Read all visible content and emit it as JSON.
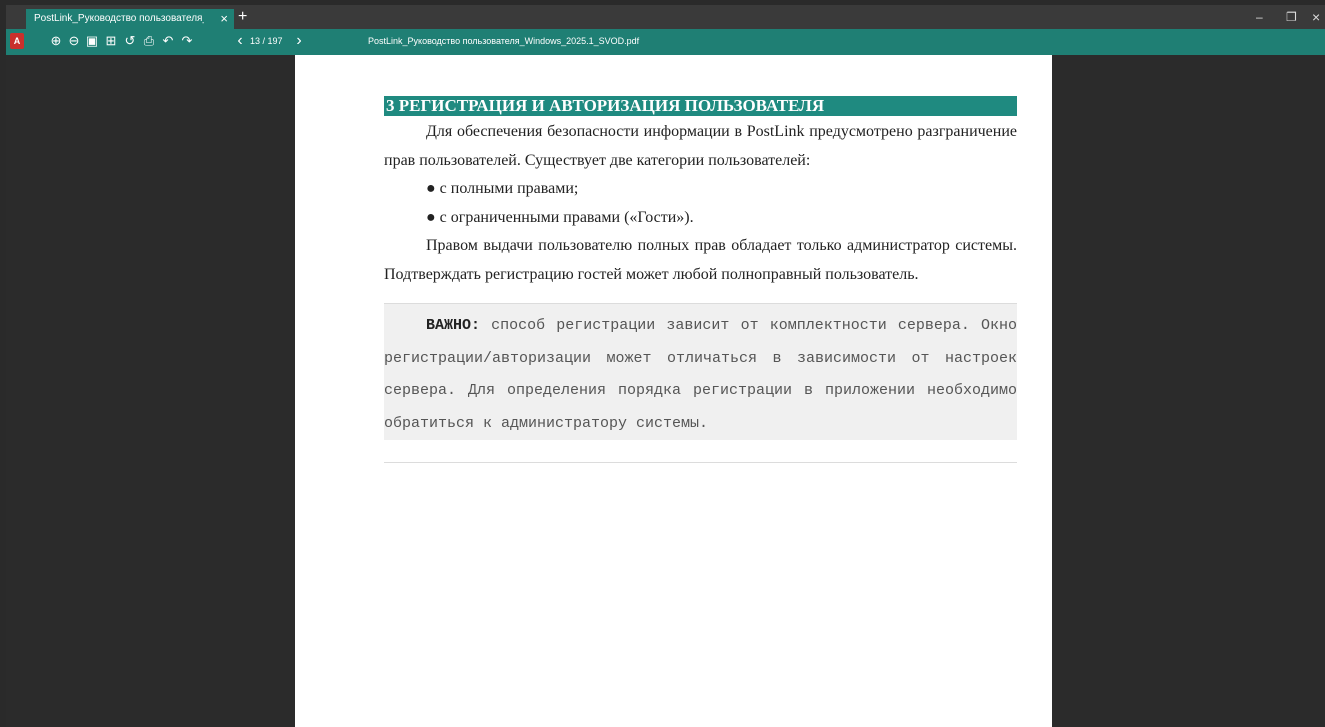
{
  "window": {
    "tab_title": "PostLink_Руководство пользователя_Wi...",
    "tab_close": "×",
    "new_tab": "+",
    "minimize": "–",
    "restore": "❐",
    "close": "×"
  },
  "toolbar": {
    "pdf_icon_label": "A",
    "zoom_in": "⊕",
    "zoom_out": "⊖",
    "fit_page": "▣",
    "fit_width": "⊞",
    "rotate": "↺",
    "print": "⎙",
    "undo": "↶",
    "redo": "↷",
    "prev_page": "‹",
    "page_indicator": "13 / 197",
    "next_page": "›",
    "file_name": "PostLink_Руководство пользователя_Windows_2025.1_SVOD.pdf"
  },
  "document": {
    "heading": "3 РЕГИСТРАЦИЯ И АВТОРИЗАЦИЯ ПОЛЬЗОВАТЕЛЯ",
    "intro": "Для обеспечения безопасности информации в PostLink предусмотрено разграничение прав пользователей. Существует две категории пользователей:",
    "bullets": [
      "● с полными правами;",
      "● с ограниченными правами («Гости»)."
    ],
    "rights": "Правом выдачи пользователю полных прав обладает только администратор системы. Подтверждать регистрацию гостей может любой полноправный пользователь.",
    "note_label": "ВАЖНО:",
    "note_text": " способ регистрации зависит от комплектности сервера. Окно регистрации/авторизации может отличаться в зависимости от настроек сервера. Для определения порядка регистрации в приложении необходимо обратиться к администратору системы."
  },
  "colors": {
    "accent": "#1f7f74",
    "heading_bg": "#1f8a80",
    "viewer_bg": "#2b2b2b",
    "note_bg": "#f0f0f0"
  }
}
